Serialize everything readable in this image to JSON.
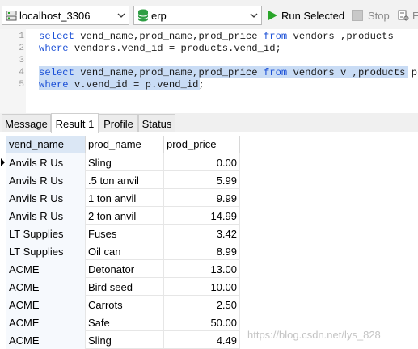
{
  "toolbar": {
    "connection": "localhost_3306",
    "database": "erp",
    "run_selected": "Run Selected",
    "stop": "Stop",
    "explain": "E"
  },
  "editor": {
    "line_numbers": [
      "1",
      "2",
      "3",
      "4",
      "5"
    ],
    "lines": [
      [
        {
          "t": "select",
          "k": true
        },
        {
          "t": " vend_name,prod_name,prod_price ",
          "k": false
        },
        {
          "t": "from",
          "k": true
        },
        {
          "t": " vendors ,products",
          "k": false
        }
      ],
      [
        {
          "t": "where",
          "k": true
        },
        {
          "t": " vendors.vend_id = products.vend_id;",
          "k": false
        }
      ],
      [],
      [
        {
          "t": "select",
          "k": true
        },
        {
          "t": " vend_name,prod_name,prod_price ",
          "k": false
        },
        {
          "t": "from",
          "k": true
        },
        {
          "t": " vendors v ,products p",
          "k": false
        }
      ],
      [
        {
          "t": "where",
          "k": true
        },
        {
          "t": " v.vend_id = p.vend_id;",
          "k": false
        }
      ]
    ]
  },
  "tabs": [
    {
      "label": "Message",
      "active": false
    },
    {
      "label": "Result 1",
      "active": true
    },
    {
      "label": "Profile",
      "active": false
    },
    {
      "label": "Status",
      "active": false
    }
  ],
  "grid": {
    "columns": [
      "vend_name",
      "prod_name",
      "prod_price"
    ],
    "rows": [
      [
        "Anvils R Us",
        "Sling",
        "0.00"
      ],
      [
        "Anvils R Us",
        ".5 ton anvil",
        "5.99"
      ],
      [
        "Anvils R Us",
        "1 ton anvil",
        "9.99"
      ],
      [
        "Anvils R Us",
        "2 ton anvil",
        "14.99"
      ],
      [
        "LT Supplies",
        "Fuses",
        "3.42"
      ],
      [
        "LT Supplies",
        "Oil can",
        "8.99"
      ],
      [
        "ACME",
        "Detonator",
        "13.00"
      ],
      [
        "ACME",
        "Bird seed",
        "10.00"
      ],
      [
        "ACME",
        "Carrots",
        "2.50"
      ],
      [
        "ACME",
        "Safe",
        "50.00"
      ],
      [
        "ACME",
        "Sling",
        "4.49"
      ]
    ]
  },
  "watermark": "https://blog.csdn.net/lys_828",
  "colors": {
    "keyword": "#1a4fd6",
    "selection": "#c9dcf5",
    "run_green": "#2aa52a",
    "db_green": "#2f9e44"
  }
}
